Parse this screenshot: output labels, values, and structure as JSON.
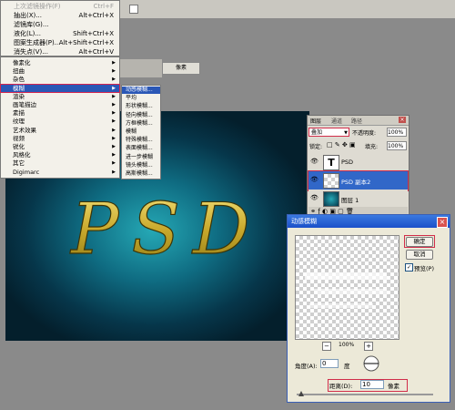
{
  "filter_menu": {
    "items": [
      {
        "label": "上次滤镜操作(F)",
        "shortcut": "Ctrl+F",
        "disabled": true
      },
      {
        "label": "抽出(X)...",
        "shortcut": "Alt+Ctrl+X"
      },
      {
        "label": "滤镜库(G)..."
      },
      {
        "label": "液化(L)...",
        "shortcut": "Shift+Ctrl+X"
      },
      {
        "label": "图案生成器(P)...",
        "shortcut": "Alt+Shift+Ctrl+X"
      },
      {
        "label": "消失点(V)...",
        "shortcut": "Alt+Ctrl+V"
      }
    ],
    "categories": [
      "像素化",
      "扭曲",
      "杂色",
      "模糊",
      "渲染",
      "画笔描边",
      "素描",
      "纹理",
      "艺术效果",
      "视频",
      "锐化",
      "风格化",
      "其它",
      "Digimarc"
    ],
    "selected_category": "模糊",
    "blur_submenu": [
      "动感模糊...",
      "平均",
      "形状模糊...",
      "径向模糊...",
      "方框模糊...",
      "模糊",
      "特殊模糊...",
      "表面模糊...",
      "进一步模糊",
      "镜头模糊...",
      "高斯模糊..."
    ],
    "selected_blur": "动感模糊...",
    "toolbar_tab": "像素"
  },
  "canvas": {
    "text": "PSD",
    "colors": {
      "glow": "#25a8b5",
      "edge": "#041f2c",
      "text_fill": "#d7c24a"
    }
  },
  "layers_panel": {
    "tabs": [
      "图层",
      "通道",
      "路径"
    ],
    "blend_mode": "叠加",
    "opacity_label": "不透明度:",
    "opacity_value": "100%",
    "lock_label": "锁定:",
    "fill_label": "填充:",
    "fill_value": "100%",
    "layers": [
      {
        "name": "PSD",
        "type": "text"
      },
      {
        "name": "PSD 副本2",
        "type": "image",
        "selected": true
      },
      {
        "name": "图层 1",
        "type": "image"
      }
    ]
  },
  "dialog": {
    "title": "动感模糊",
    "ok_label": "确定",
    "cancel_label": "取消",
    "preview_label": "预览(P)",
    "preview_checked": true,
    "zoom_value": "100%",
    "angle_label": "角度(A):",
    "angle_value": "0",
    "angle_unit": "度",
    "distance_label": "距离(D):",
    "distance_value": "10",
    "distance_unit": "像素",
    "colors": {
      "highlight": "#d12d4a",
      "title_bar": "#1b4fc9"
    }
  }
}
